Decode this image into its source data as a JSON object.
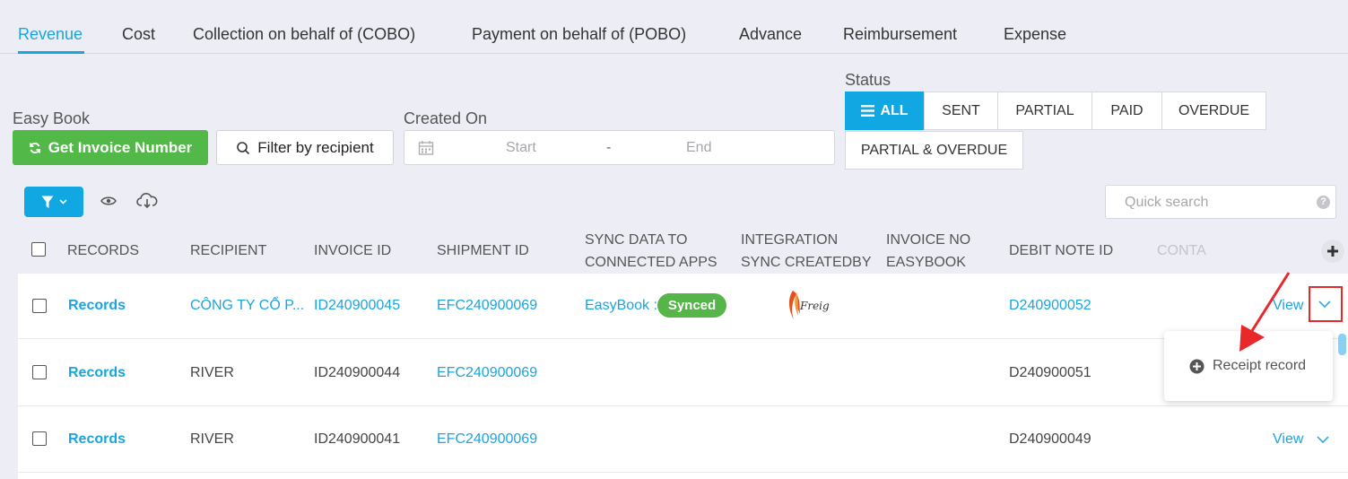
{
  "tabs": [
    {
      "label": "Revenue",
      "active": true
    },
    {
      "label": "Cost"
    },
    {
      "label": "Collection on behalf of (COBO)"
    },
    {
      "label": "Payment on behalf of (POBO)"
    },
    {
      "label": "Advance"
    },
    {
      "label": "Reimbursement"
    },
    {
      "label": "Expense"
    }
  ],
  "easy_book": {
    "label": "Easy Book",
    "get_invoice_label": "Get Invoice Number",
    "filter_label": "Filter by recipient"
  },
  "created_on": {
    "label": "Created On",
    "start_placeholder": "Start",
    "separator": "-",
    "end_placeholder": "End"
  },
  "status": {
    "label": "Status",
    "options": [
      "ALL",
      "SENT",
      "PARTIAL",
      "PAID",
      "OVERDUE",
      "PARTIAL & OVERDUE"
    ],
    "selected": "ALL"
  },
  "quick_search": {
    "placeholder": "Quick search",
    "help_glyph": "?"
  },
  "columns": [
    "RECORDS",
    "RECIPIENT",
    "INVOICE ID",
    "SHIPMENT ID",
    "SYNC DATA TO",
    "CONNECTED APPS",
    "INTEGRATION",
    "SYNC CREATEDBY",
    "INVOICE NO",
    "EASYBOOK",
    "DEBIT NOTE ID",
    "CONTA"
  ],
  "rows": [
    {
      "records": "Records",
      "recipient": "CÔNG TY CỔ P...",
      "invoice_id": "ID240900045",
      "shipment_id": "EFC240900069",
      "sync_app": "EasyBook :",
      "sync_status": "Synced",
      "debit_note": "D240900052",
      "action": "View"
    },
    {
      "records": "Records",
      "recipient": "RIVER",
      "invoice_id": "ID240900044",
      "shipment_id": "EFC240900069",
      "debit_note": "D240900051"
    },
    {
      "records": "Records",
      "recipient": "RIVER",
      "invoice_id": "ID240900041",
      "shipment_id": "EFC240900069",
      "debit_note": "D240900049",
      "action": "View"
    }
  ],
  "integration_logo_text": "Freight",
  "popover": {
    "item_label": "Receipt record"
  },
  "colors": {
    "accent": "#1ba4dd",
    "green": "#52b848",
    "highlight": "#e8282b"
  }
}
